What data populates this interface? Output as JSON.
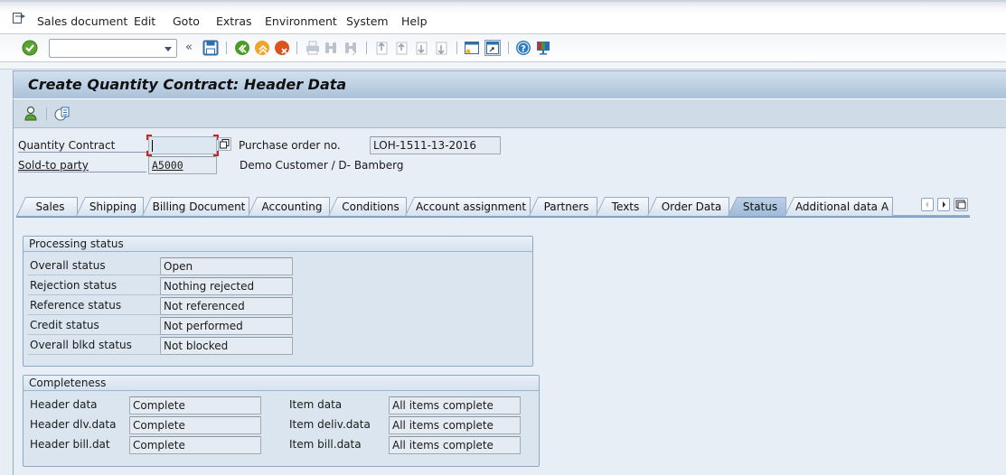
{
  "menubar": {
    "icon": "menu-icon",
    "items": [
      {
        "label": "Sales document",
        "mnemonic": "S"
      },
      {
        "label": "Edit",
        "mnemonic": "E"
      },
      {
        "label": "Goto",
        "mnemonic": "G"
      },
      {
        "label": "Extras",
        "mnemonic": "a"
      },
      {
        "label": "Environment",
        "mnemonic": "v"
      },
      {
        "label": "System",
        "mnemonic": "y"
      },
      {
        "label": "Help",
        "mnemonic": "H"
      }
    ]
  },
  "toolbar": {
    "command_field_value": "",
    "icons": [
      "enter-check-icon",
      "collapse-chevron-icon",
      "save-icon",
      "back-icon",
      "exit-icon",
      "cancel-icon",
      "print-icon",
      "find-icon",
      "find-next-icon",
      "first-page-icon",
      "previous-page-icon",
      "next-page-icon",
      "last-page-icon",
      "create-session-icon",
      "generate-shortcut-icon",
      "help-icon",
      "customize-layout-icon"
    ]
  },
  "title": "Create Quantity Contract: Header Data",
  "app_toolbar": {
    "icons": [
      "business-partner-icon",
      "display-document-flow-icon"
    ]
  },
  "header": {
    "quantity_contract_label": "Quantity Contract",
    "quantity_contract_value": "",
    "purchase_order_label": "Purchase order no.",
    "purchase_order_value": "LOH-1511-13-2016",
    "sold_to_label": "Sold-to party",
    "sold_to_value": "A5000",
    "sold_to_description": "Demo Customer / D- Bamberg"
  },
  "tabs": [
    {
      "label": "Sales",
      "active": false
    },
    {
      "label": "Shipping",
      "active": false
    },
    {
      "label": "Billing Document",
      "active": false
    },
    {
      "label": "Accounting",
      "active": false
    },
    {
      "label": "Conditions",
      "active": false
    },
    {
      "label": "Account assignment",
      "active": false
    },
    {
      "label": "Partners",
      "active": false
    },
    {
      "label": "Texts",
      "active": false
    },
    {
      "label": "Order Data",
      "active": false
    },
    {
      "label": "Status",
      "active": true
    },
    {
      "label": "Additional data A",
      "active": false
    }
  ],
  "processing_status": {
    "title": "Processing status",
    "rows": [
      {
        "label": "Overall status",
        "value": "Open"
      },
      {
        "label": "Rejection status",
        "value": "Nothing rejected"
      },
      {
        "label": "Reference status",
        "value": "Not referenced"
      },
      {
        "label": "Credit status",
        "value": "Not performed"
      },
      {
        "label": "Overall blkd status",
        "value": "Not blocked"
      }
    ]
  },
  "completeness": {
    "title": "Completeness",
    "left": [
      {
        "label": "Header data",
        "value": "Complete"
      },
      {
        "label": "Header dlv.data",
        "value": "Complete"
      },
      {
        "label": "Header bill.dat",
        "value": "Complete"
      }
    ],
    "right": [
      {
        "label": "Item data",
        "value": "All items complete"
      },
      {
        "label": "Item deliv.data",
        "value": "All items complete"
      },
      {
        "label": "Item bill.data",
        "value": "All items complete"
      }
    ]
  },
  "colors": {
    "focus": "#d21f1f",
    "active_tab": "#a9c3de",
    "title_bar": "#bcd0e6"
  }
}
